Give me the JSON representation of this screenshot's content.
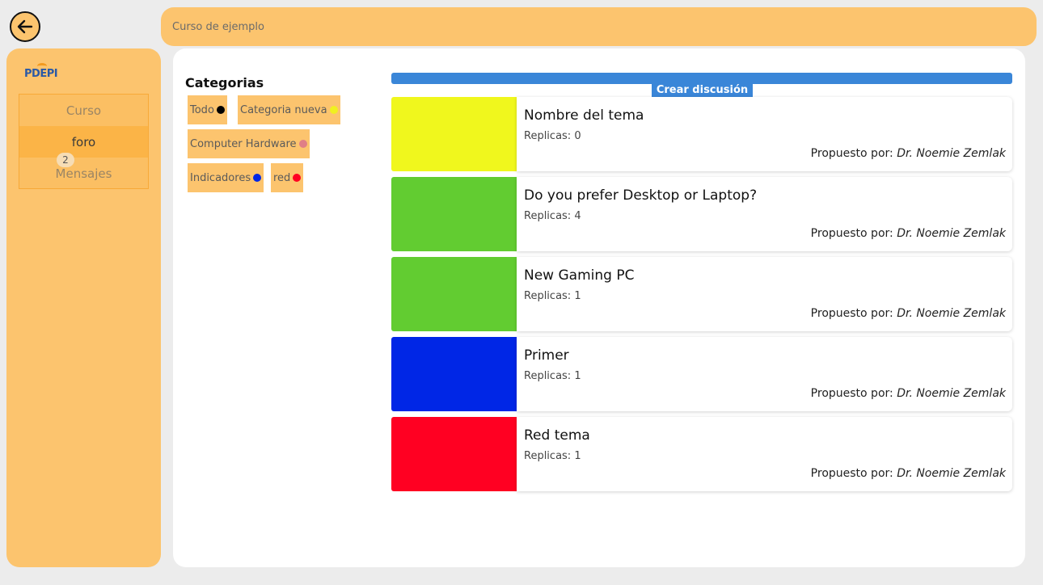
{
  "header": {
    "course_title": "Curso de ejemplo"
  },
  "sidebar": {
    "logo_text": "PDEPI",
    "items": [
      {
        "label": "Curso"
      },
      {
        "label": "foro"
      },
      {
        "label": "Mensajes",
        "badge": "2"
      }
    ]
  },
  "categories": {
    "title": "Categorias",
    "items": [
      {
        "label": "Todo",
        "color": "#000000"
      },
      {
        "label": "Categoria nueva",
        "color": "#f0f020"
      },
      {
        "label": "Computer Hardware",
        "color": "#e07f86"
      },
      {
        "label": "Indicadores",
        "color": "#0026e6"
      },
      {
        "label": "red",
        "color": "#ff0022"
      }
    ]
  },
  "create_button": {
    "label": "Crear discusión"
  },
  "topics": [
    {
      "title": "Nombre del tema",
      "replies": "Replicas: 0",
      "author_prefix": "Propuesto por:",
      "author": "Dr. Noemie Zemlak",
      "color": "#f0f71d"
    },
    {
      "title": "Do you prefer Desktop or Laptop?",
      "replies": "Replicas: 4",
      "author_prefix": "Propuesto por:",
      "author": "Dr. Noemie Zemlak",
      "color": "#62cc31"
    },
    {
      "title": "New Gaming PC",
      "replies": "Replicas: 1",
      "author_prefix": "Propuesto por:",
      "author": "Dr. Noemie Zemlak",
      "color": "#62cc31"
    },
    {
      "title": "Primer",
      "replies": "Replicas: 1",
      "author_prefix": "Propuesto por:",
      "author": "Dr. Noemie Zemlak",
      "color": "#0026e6"
    },
    {
      "title": "Red tema",
      "replies": "Replicas: 1",
      "author_prefix": "Propuesto por:",
      "author": "Dr. Noemie Zemlak",
      "color": "#ff0022"
    }
  ],
  "colors": {
    "accent": "#fcc46e",
    "primary": "#3a86d8"
  }
}
